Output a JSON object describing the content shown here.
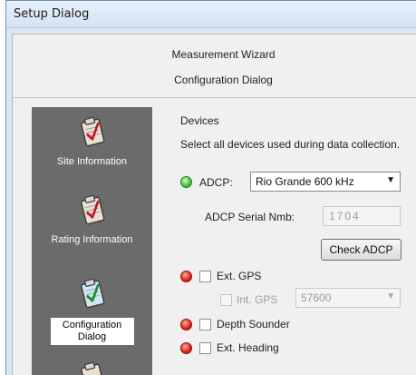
{
  "window": {
    "title": "Setup Dialog"
  },
  "header": {
    "title": "Measurement Wizard",
    "subtitle": "Configuration Dialog"
  },
  "sidebar": {
    "items": [
      {
        "label": "Site Information",
        "icon": "clipboard-check-icon",
        "active": false
      },
      {
        "label": "Rating Information",
        "icon": "clipboard-check-icon",
        "active": false
      },
      {
        "label": "Configuration Dialog",
        "icon": "clipboard-check-icon",
        "active": true
      }
    ]
  },
  "devices": {
    "group_label": "Devices",
    "instruction": "Select all devices used during data collection.",
    "adcp": {
      "label": "ADCP:",
      "selected": "Rio Grande 600 kHz",
      "status_color": "#48c53a",
      "serial_label": "ADCP Serial Nmb:",
      "serial_value": "1704",
      "check_button": "Check ADCP"
    },
    "ext_gps": {
      "label": "Ext. GPS",
      "checked": false,
      "status_color": "#e0291a"
    },
    "int_gps": {
      "label": "Int. GPS",
      "checked": false,
      "enabled": false,
      "baud": "57600"
    },
    "depth_sounder": {
      "label": "Depth Sounder",
      "checked": false,
      "status_color": "#e0291a"
    },
    "ext_heading": {
      "label": "Ext. Heading",
      "checked": false,
      "status_color": "#e0291a"
    }
  }
}
